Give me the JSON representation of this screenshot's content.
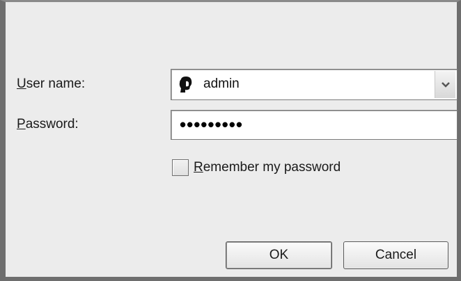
{
  "login_form": {
    "username_label_key": "U",
    "username_label_rest": "ser name:",
    "username_value": "admin",
    "password_label_key": "P",
    "password_label_rest": "assword:",
    "password_masked": "•••••••••",
    "remember_label_key": "R",
    "remember_label_rest": "emember my password",
    "remember_checked": false
  },
  "buttons": {
    "ok_label": "OK",
    "cancel_label": "Cancel"
  },
  "icons": {
    "user_icon": "user-avatar-icon",
    "dropdown_icon": "chevron-down-icon"
  },
  "colors": {
    "dialog_bg": "#ececec",
    "frame": "#6e6e6e"
  }
}
